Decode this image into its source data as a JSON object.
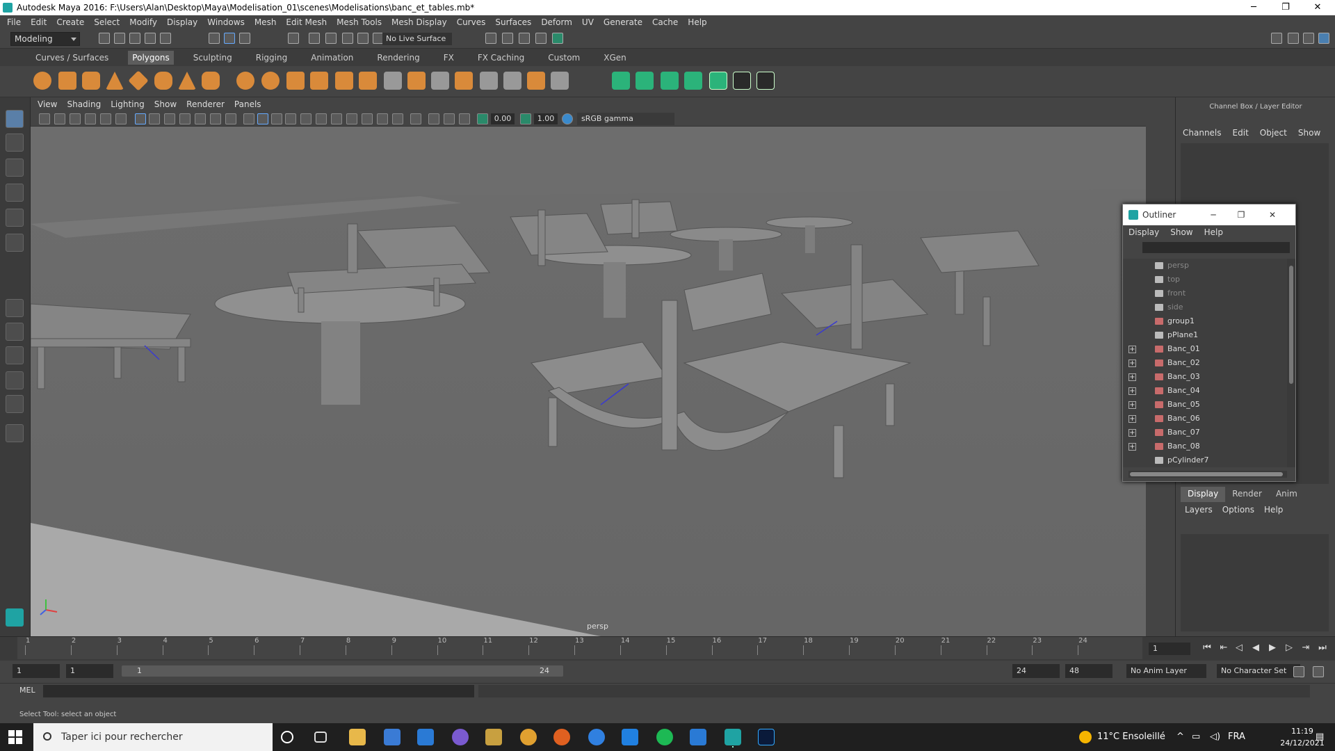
{
  "window": {
    "title": "Autodesk Maya 2016: F:\\Users\\Alan\\Desktop\\Maya\\Modelisation_01\\scenes\\Modelisations\\banc_et_tables.mb*",
    "minimize": "─",
    "maximize": "❐",
    "close": "✕"
  },
  "menu": [
    "File",
    "Edit",
    "Create",
    "Select",
    "Modify",
    "Display",
    "Windows",
    "Mesh",
    "Edit Mesh",
    "Mesh Tools",
    "Mesh Display",
    "Curves",
    "Surfaces",
    "Deform",
    "UV",
    "Generate",
    "Cache",
    "Help"
  ],
  "toolbar": {
    "mode": "Modeling",
    "live_surface": "No Live Surface"
  },
  "shelf_tabs": [
    "Curves / Surfaces",
    "Polygons",
    "Sculpting",
    "Rigging",
    "Animation",
    "Rendering",
    "FX",
    "FX Caching",
    "Custom",
    "XGen"
  ],
  "active_shelf": "Polygons",
  "viewport_menu": [
    "View",
    "Shading",
    "Lighting",
    "Show",
    "Renderer",
    "Panels"
  ],
  "viewport_tools": {
    "near": "0.00",
    "far": "1.00",
    "color_space": "sRGB gamma"
  },
  "viewport": {
    "camera_label": "persp"
  },
  "channel_box": {
    "title": "Channel Box / Layer Editor",
    "menu": [
      "Channels",
      "Edit",
      "Object",
      "Show"
    ]
  },
  "layer_editor": {
    "tabs": [
      "Display",
      "Render",
      "Anim"
    ],
    "active_tab": "Display",
    "menu": [
      "Layers",
      "Options",
      "Help"
    ]
  },
  "outliner": {
    "title": "Outliner",
    "menu": [
      "Display",
      "Show",
      "Help"
    ],
    "items": [
      {
        "label": "persp",
        "expand": "",
        "dim": true,
        "icon": "camera-icon"
      },
      {
        "label": "top",
        "expand": "",
        "dim": true,
        "icon": "camera-icon"
      },
      {
        "label": "front",
        "expand": "",
        "dim": true,
        "icon": "camera-icon"
      },
      {
        "label": "side",
        "expand": "",
        "dim": true,
        "icon": "camera-icon"
      },
      {
        "label": "group1",
        "expand": "",
        "dim": false,
        "icon": "mesh-icon"
      },
      {
        "label": "pPlane1",
        "expand": "",
        "dim": false,
        "icon": "transform-icon"
      },
      {
        "label": "Banc_01",
        "expand": "+",
        "dim": false,
        "icon": "mesh-icon"
      },
      {
        "label": "Banc_02",
        "expand": "+",
        "dim": false,
        "icon": "mesh-icon"
      },
      {
        "label": "Banc_03",
        "expand": "+",
        "dim": false,
        "icon": "mesh-icon"
      },
      {
        "label": "Banc_04",
        "expand": "+",
        "dim": false,
        "icon": "mesh-icon"
      },
      {
        "label": "Banc_05",
        "expand": "+",
        "dim": false,
        "icon": "mesh-icon"
      },
      {
        "label": "Banc_06",
        "expand": "+",
        "dim": false,
        "icon": "mesh-icon"
      },
      {
        "label": "Banc_07",
        "expand": "+",
        "dim": false,
        "icon": "mesh-icon"
      },
      {
        "label": "Banc_08",
        "expand": "+",
        "dim": false,
        "icon": "mesh-icon"
      },
      {
        "label": "pCylinder7",
        "expand": "",
        "dim": false,
        "icon": "transform-icon"
      }
    ]
  },
  "timeline": {
    "ticks": [
      "1",
      "2",
      "3",
      "4",
      "5",
      "6",
      "7",
      "8",
      "9",
      "10",
      "11",
      "12",
      "13",
      "14",
      "15",
      "16",
      "17",
      "18",
      "19",
      "20",
      "21",
      "22",
      "23",
      "24"
    ],
    "current_frame": "1"
  },
  "range": {
    "start": "1",
    "start_inner": "1",
    "bar_start": "1",
    "bar_end": "24",
    "end_inner": "24",
    "end": "48",
    "anim_layer": "No Anim Layer",
    "char_set": "No Character Set"
  },
  "command": {
    "mode": "MEL"
  },
  "help_line": "Select Tool: select an object",
  "taskbar": {
    "search_placeholder": "Taper ici pour rechercher",
    "weather": "11°C  Ensoleillé",
    "lang": "FRA",
    "time": "11:19",
    "date": "24/12/2021"
  },
  "colors": {
    "maya_accent": "#1fa3a3",
    "viewport_bg": "#6b6b6b",
    "panel_bg": "#444444"
  }
}
